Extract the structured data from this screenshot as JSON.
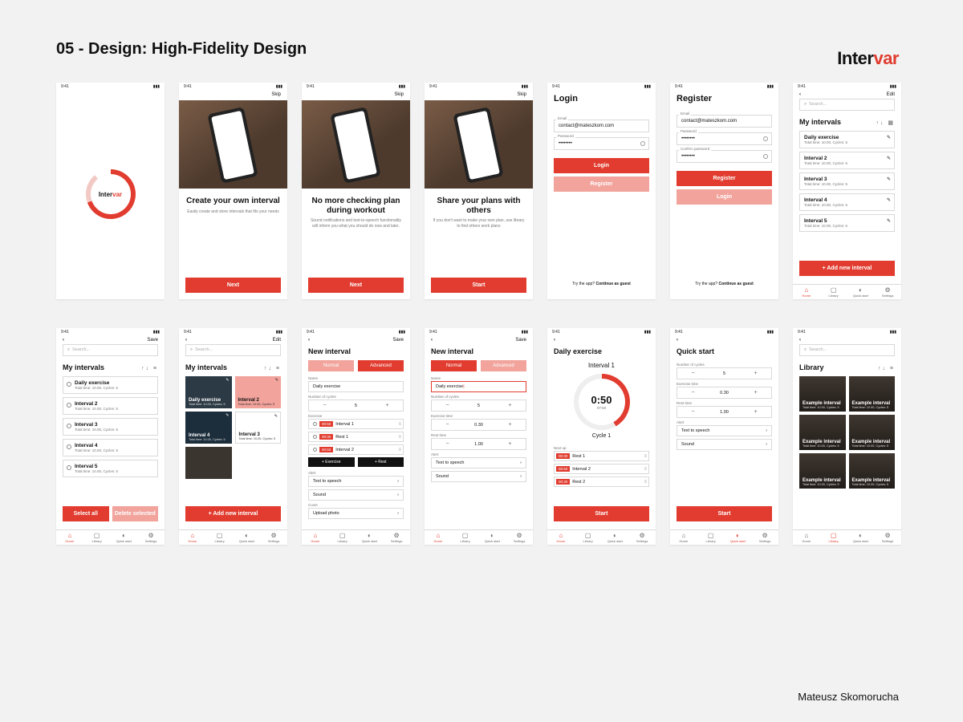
{
  "page": {
    "title": "05 - Design: High-Fidelity Design",
    "brand_a": "Inter",
    "brand_b": "var",
    "credit": "Mateusz Skomorucha"
  },
  "status": {
    "time": "9:41"
  },
  "common": {
    "skip": "Skip",
    "save": "Save",
    "edit": "Edit",
    "back": "‹",
    "search_ph": "Search...",
    "try_a": "Try the app? ",
    "try_b": "Continue as guest"
  },
  "tabs": {
    "home": "Home",
    "library": "Library",
    "quick": "Quick start",
    "settings": "Settings"
  },
  "splash": {
    "logo_a": "Inter",
    "logo_b": "var"
  },
  "onboard": [
    {
      "title": "Create your own interval",
      "sub": "Easily create and store intervals that fits your needs",
      "btn": "Next"
    },
    {
      "title": "No more checking plan during workout",
      "sub": "Sound notifications and text-to-speech functionality will inform you what you should do now and later.",
      "btn": "Next"
    },
    {
      "title": "Share your plans with others",
      "sub": "If you don't want to make your own plan, use library to find others work plans",
      "btn": "Start"
    }
  ],
  "login": {
    "title": "Login",
    "email_l": "Email",
    "email_v": "contact@mateszkom.com",
    "pass_l": "Password",
    "pass_v": "••••••••",
    "login_btn": "Login",
    "register_btn": "Register"
  },
  "register": {
    "title": "Register",
    "email_l": "Email",
    "email_v": "contact@mateszkom.com",
    "pass_l": "Password",
    "pass_v": "••••••••",
    "conf_l": "Confirm password",
    "conf_v": "••••••••",
    "register_btn": "Register",
    "login_btn": "Login"
  },
  "myint": {
    "title": "My intervals",
    "items": [
      {
        "t": "Daily exercise",
        "s": "Total time: 10.00, Cycles: 5"
      },
      {
        "t": "Interval 2",
        "s": "Total time: 10.00, Cycles: 5"
      },
      {
        "t": "Interval 3",
        "s": "Total time: 10.00, Cycles: 5"
      },
      {
        "t": "Interval 4",
        "s": "Total time: 10.00, Cycles: 5"
      },
      {
        "t": "Interval 5",
        "s": "Total time: 10.00, Cycles: 5"
      }
    ],
    "add": "+   Add new interval",
    "select_all": "Select all",
    "delete_sel": "Delete selected"
  },
  "newint": {
    "title": "New interval",
    "seg_normal": "Normal",
    "seg_adv": "Advanced",
    "name_l": "Name",
    "name_v": "Daily exercise",
    "cycles_l": "Number of cycles",
    "cycles_v": "5",
    "extime_l": "Exercise time",
    "extime_v": "0.30",
    "rest_l": "Rest time",
    "rest_v": "1.00",
    "ex_l": "Exercise",
    "rows": [
      {
        "badge": "00:50",
        "name": "Interval 1"
      },
      {
        "badge": "00:30",
        "name": "Rest 1"
      },
      {
        "badge": "00:50",
        "name": "Interval 2"
      }
    ],
    "add_ex": "+   Exercise",
    "add_rest": "+   Rest",
    "alert_l": "Alert",
    "alert1": "Text to speech",
    "alert2": "Sound",
    "cover_l": "Cover",
    "cover_v": "Upload photo"
  },
  "run": {
    "title": "Daily exercise",
    "sub": "Interval 1",
    "time": "0:50",
    "total": "07:50",
    "cycle": "Cycle 1",
    "next_l": "Next up",
    "rows": [
      {
        "badge": "00:30",
        "name": "Rest 1"
      },
      {
        "badge": "00:50",
        "name": "Interval 2"
      },
      {
        "badge": "00:30",
        "name": "Rest 2"
      }
    ],
    "start": "Start"
  },
  "quick": {
    "title": "Quick start",
    "cycles_l": "Number of cycles",
    "cycles_v": "5",
    "extime_l": "Exercise time",
    "extime_v": "0.30",
    "rest_l": "Rest time",
    "rest_v": "1.00",
    "alert_l": "Alert",
    "alert1": "Text to speech",
    "alert2": "Sound",
    "start": "Start"
  },
  "library": {
    "title": "Library",
    "item_t": "Example interval",
    "item_s": "Total time: 10.00, Cycles: 5"
  }
}
